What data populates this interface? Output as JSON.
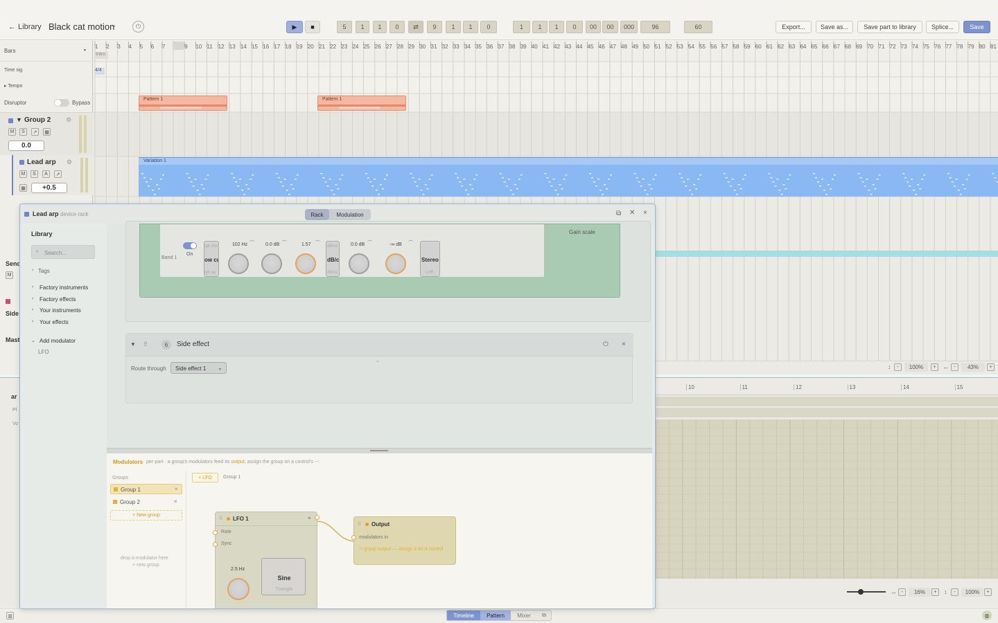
{
  "header": {
    "back_label": "← Library",
    "title": "Black cat motion",
    "title_caret": "▾",
    "power_icon": "⏻"
  },
  "transport": {
    "play": "▶",
    "stop": "■",
    "loop": "⇄",
    "pos1": [
      "5",
      "1",
      "1",
      "0"
    ],
    "pos2": [
      "9",
      "1",
      "1",
      "0"
    ],
    "pos3": [
      "1",
      "1",
      "1",
      "0",
      "00",
      "00",
      "000",
      "96"
    ],
    "tempo": "60"
  },
  "toolbar": {
    "export": "Export...",
    "save_as": "Save as...",
    "save_part": "Save part to library",
    "splice": "Splice...",
    "save": "Save"
  },
  "ruler": {
    "bars_label": "Bars",
    "time_sig_label": "Time sig",
    "tempo_label": "▸ Tempo",
    "intro": "Intro",
    "time_sig": "4/4",
    "numbers": [
      "1",
      "2",
      "3",
      "4",
      "5",
      "6",
      "7",
      "8",
      "9",
      "10",
      "11",
      "12",
      "13",
      "14",
      "15",
      "16",
      "17",
      "18",
      "19",
      "20",
      "21",
      "22",
      "23",
      "24",
      "25",
      "26",
      "27",
      "28",
      "29",
      "30",
      "31",
      "32",
      "33",
      "34",
      "35",
      "36",
      "37",
      "38",
      "39",
      "40",
      "41",
      "42",
      "43",
      "44",
      "45",
      "46",
      "47",
      "48",
      "49",
      "50",
      "51",
      "52",
      "53",
      "54",
      "55",
      "56",
      "57",
      "58",
      "59",
      "60",
      "61",
      "62",
      "63",
      "64",
      "65",
      "66",
      "67",
      "68",
      "69",
      "70",
      "71",
      "72",
      "73",
      "74",
      "75",
      "76",
      "77",
      "78",
      "79",
      "80",
      "81"
    ]
  },
  "tracks": {
    "disruptor": {
      "name": "Disruptor",
      "bypass": "Bypass"
    },
    "group2": {
      "name": "Group 2",
      "m": "M",
      "s": "S",
      "vol": "0.0"
    },
    "lead": {
      "name": "Lead arp",
      "m": "M",
      "s": "S",
      "a": "A",
      "vol": "+0.5"
    },
    "clips": {
      "pattern1": "Pattern 1",
      "pattern2": "Pattern 1",
      "variation": "Variation 1"
    },
    "partial": {
      "send": "Send",
      "side": "Side",
      "mast": "Mast",
      "ar": "ar",
      "pl": "Pl",
      "vo": "Vo",
      "m": "M"
    }
  },
  "zoom_top": {
    "pct1": "100%",
    "pct2": "43%",
    "minus": "-",
    "plus": "+"
  },
  "bottom_ruler": [
    "10",
    "11",
    "12",
    "13",
    "14",
    "15"
  ],
  "zoom_bottom": {
    "pct1": "16%",
    "pct2": "100%"
  },
  "bottom_tabs": {
    "timeline": "Timeline",
    "pattern": "Pattern",
    "mixer": "Mixer"
  },
  "rack": {
    "title": "Lead arp",
    "subtitle": "device rack",
    "tabs": [
      "Rack",
      "Modulation"
    ],
    "library": {
      "title": "Library",
      "search_placeholder": "Search...",
      "tags": "Tags",
      "items": [
        "Factory instruments",
        "Factory effects",
        "Your instruments",
        "Your effects"
      ],
      "add_modulator": "Add modulator",
      "lfo": "LFO"
    },
    "eq": {
      "band": "Band 1",
      "on": "On",
      "freq": "102 Hz",
      "gain": "0.0 dB",
      "q": "1.57",
      "slope_label": "dB/c",
      "gain2": "0.0 dB",
      "threshold": "-∞ dB",
      "stereo": "Stereo",
      "stereo_sub": "Left",
      "gain_scale": "Gain scale",
      "type_top": "igh she",
      "type": "ow cu",
      "type_bot": "igh pa",
      "slope_top": "dB/oc",
      "slope_bot": "dB/oc"
    },
    "side_effect": {
      "num": "6",
      "name": "Side effect",
      "route_label": "Route through",
      "route_value": "Side effect 1"
    },
    "modulators": {
      "title": "Modulators",
      "desc_pre": "per-part · a group's modulators feed its ",
      "desc_hl": "output",
      "desc_post": "; assign the group on a control's ⋯",
      "groups_label": "Groups",
      "groups": [
        "Group 1",
        "Group 2"
      ],
      "new_group": "+ New group",
      "drop_hint1": "drop a modulator here",
      "drop_hint2": "+ new group",
      "add_lfo": "+ LFO",
      "current_group": "Group 1",
      "lfo": {
        "name": "LFO 1",
        "rate": "Rate",
        "sync": "Sync",
        "rate_value": "2.5 Hz",
        "shape": "Sine",
        "shape_next": "Triangle"
      },
      "output": {
        "name": "Output",
        "in": "modulators in",
        "hint": "= group output — assign it on a control"
      }
    }
  },
  "colors": {
    "accent": "#6f86c8",
    "pattern": "#f2a98a",
    "variation": "#8ab8f3",
    "group": "#e3b233"
  }
}
